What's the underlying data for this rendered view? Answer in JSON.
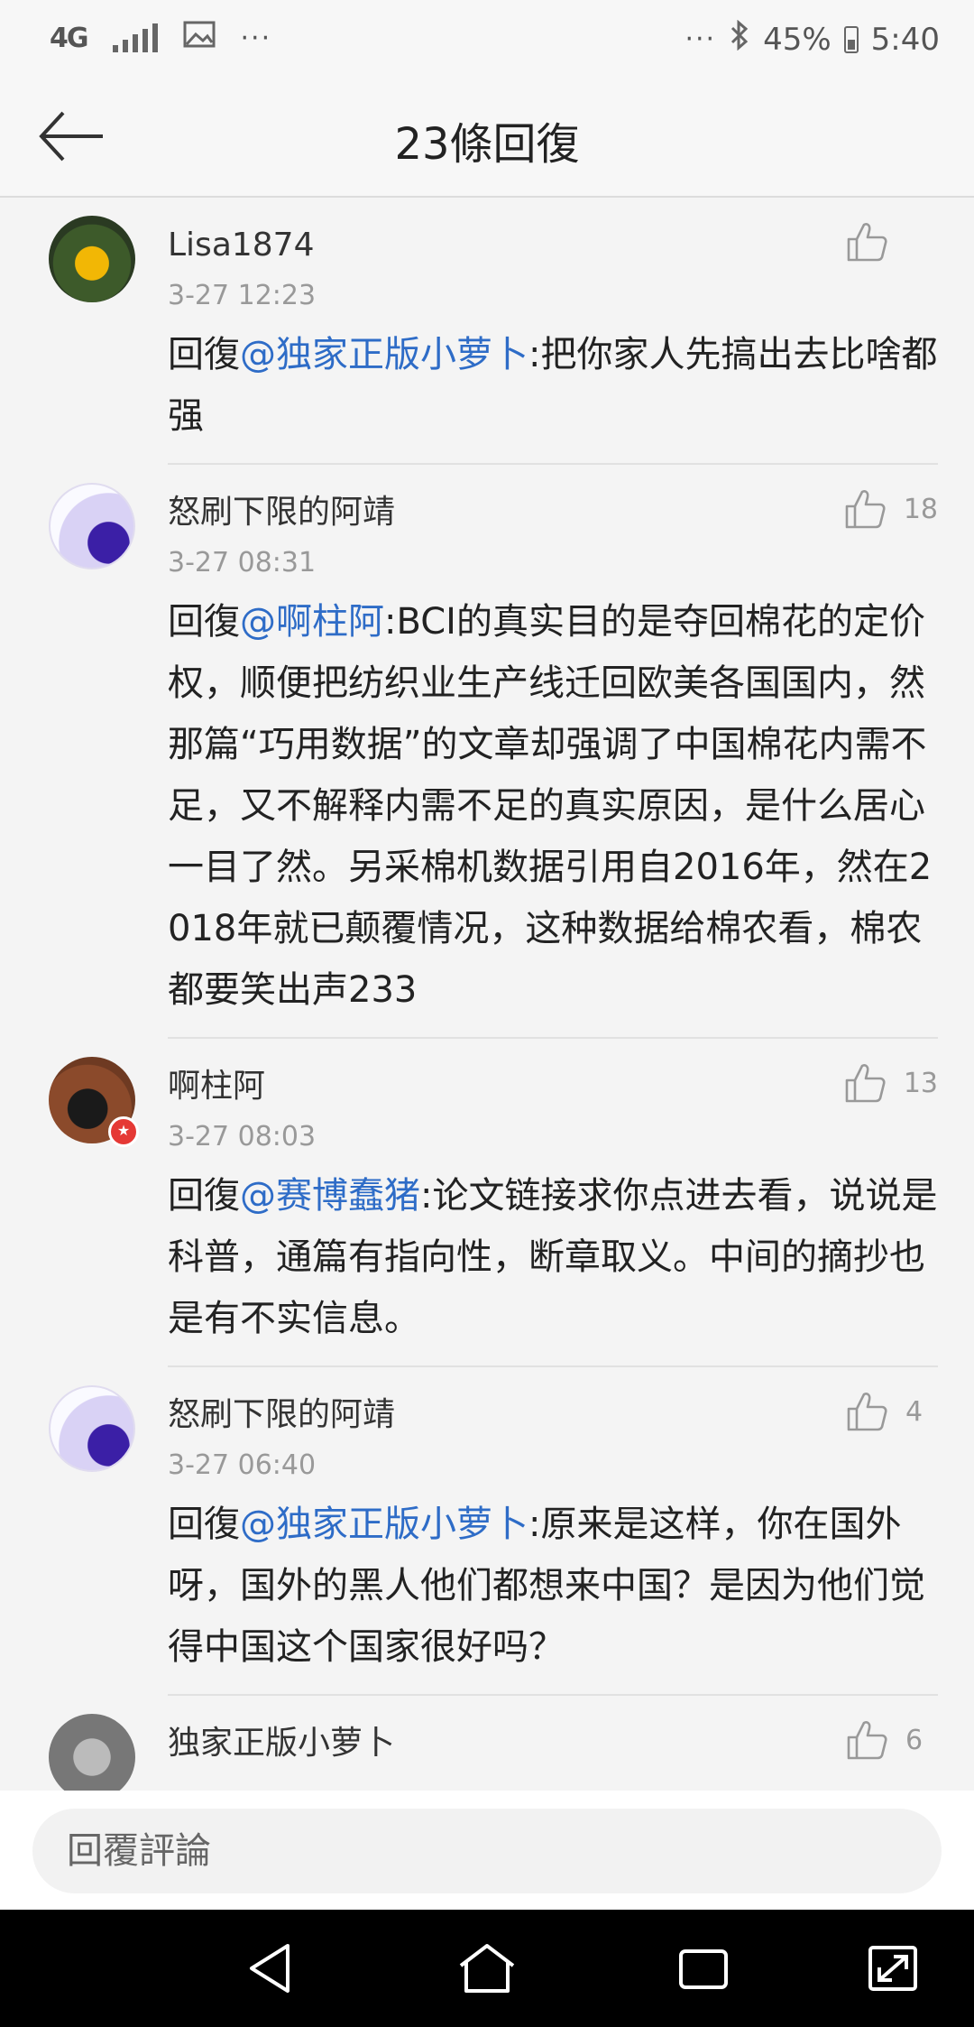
{
  "status_bar": {
    "network": "4G",
    "left_dots": "···",
    "right_dots": "···",
    "battery": "45%",
    "time": "5:40"
  },
  "header": {
    "title": "23條回復"
  },
  "comments": [
    {
      "username": "Lisa1874",
      "time": "3-27 12:23",
      "reply_prefix": "回復",
      "mention": "@独家正版小萝卜",
      "text": ":把你家人先搞出去比啥都强",
      "likes": ""
    },
    {
      "username": "怒刷下限的阿靖",
      "time": "3-27 08:31",
      "reply_prefix": "回復",
      "mention": "@啊柱阿",
      "text": ":BCI的真实目的是夺回棉花的定价权，顺便把纺织业生产线迁回欧美各国国内，然那篇“巧用数据”的文章却强调了中国棉花内需不足，又不解释内需不足的真实原因，是什么居心一目了然。另采棉机数据引用自2016年，然在2018年就已颠覆情况，这种数据给棉农看，棉农都要笑出声233",
      "likes": "18"
    },
    {
      "username": "啊柱阿",
      "time": "3-27 08:03",
      "reply_prefix": "回復",
      "mention": "@赛博蠢猪",
      "text": ":论文链接求你点进去看，说说是科普，通篇有指向性，断章取义。中间的摘抄也是有不实信息。",
      "likes": "13"
    },
    {
      "username": "怒刷下限的阿靖",
      "time": "3-27 06:40",
      "reply_prefix": "回復",
      "mention": "@独家正版小萝卜",
      "text": ":原来是这样，你在国外呀，国外的黑人他们都想来中国？是因为他们觉得中国这个国家很好吗？",
      "likes": "4"
    },
    {
      "username": "独家正版小萝卜",
      "time": "",
      "reply_prefix": "",
      "mention": "",
      "text": "",
      "likes": "6"
    }
  ],
  "reply_bar": {
    "placeholder": "回覆評論"
  },
  "colors": {
    "mention": "#2e6cc7",
    "badge": "#e53935",
    "text": "#222222",
    "meta": "#999999"
  }
}
